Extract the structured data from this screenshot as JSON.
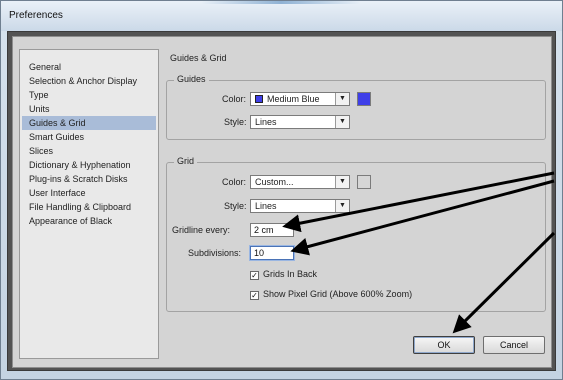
{
  "window": {
    "title": "Preferences"
  },
  "sidebar": {
    "items": [
      {
        "label": "General",
        "selected": false
      },
      {
        "label": "Selection & Anchor Display",
        "selected": false
      },
      {
        "label": "Type",
        "selected": false
      },
      {
        "label": "Units",
        "selected": false
      },
      {
        "label": "Guides & Grid",
        "selected": true
      },
      {
        "label": "Smart Guides",
        "selected": false
      },
      {
        "label": "Slices",
        "selected": false
      },
      {
        "label": "Dictionary & Hyphenation",
        "selected": false
      },
      {
        "label": "Plug-ins & Scratch Disks",
        "selected": false
      },
      {
        "label": "User Interface",
        "selected": false
      },
      {
        "label": "File Handling & Clipboard",
        "selected": false
      },
      {
        "label": "Appearance of Black",
        "selected": false
      }
    ]
  },
  "panel": {
    "title": "Guides & Grid",
    "guides": {
      "group_title": "Guides",
      "color_label": "Color:",
      "color_value": "Medium Blue",
      "color_swatch": "#3f3fe8",
      "style_label": "Style:",
      "style_value": "Lines"
    },
    "grid": {
      "group_title": "Grid",
      "color_label": "Color:",
      "color_value": "Custom...",
      "color_swatch": "#d6d6d6",
      "style_label": "Style:",
      "style_value": "Lines",
      "gridline_label": "Gridline every:",
      "gridline_value": "2 cm",
      "subdivisions_label": "Subdivisions:",
      "subdivisions_value": "10",
      "grids_in_back_label": "Grids In Back",
      "grids_in_back_checked": true,
      "pixel_grid_label": "Show Pixel Grid (Above 600% Zoom)",
      "pixel_grid_checked": true
    }
  },
  "buttons": {
    "ok": "OK",
    "cancel": "Cancel"
  },
  "icons": {
    "dropdown": "chevron-down-icon",
    "check": "check-icon"
  }
}
